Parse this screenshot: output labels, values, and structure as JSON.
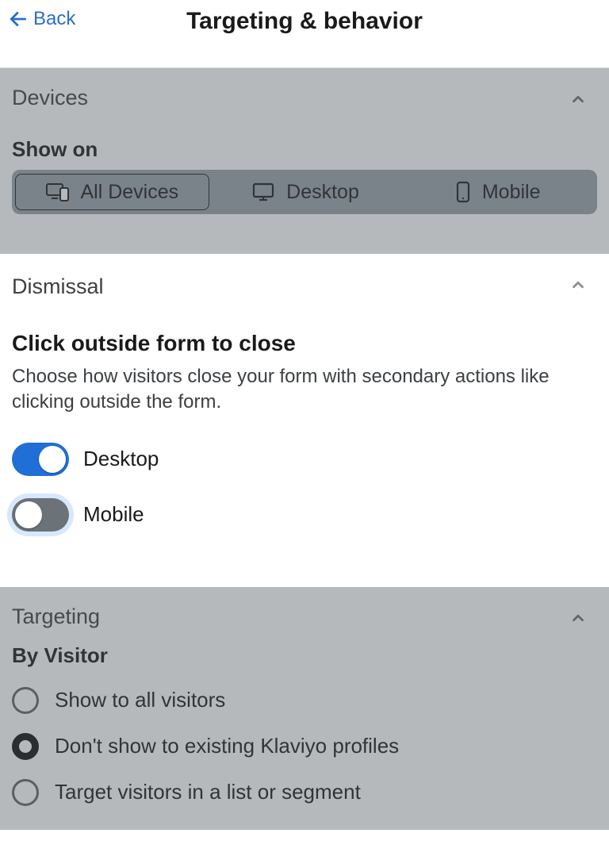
{
  "header": {
    "back_label": "Back",
    "title": "Targeting & behavior"
  },
  "devices": {
    "title": "Devices",
    "show_on_label": "Show on",
    "options": {
      "all": "All Devices",
      "desktop": "Desktop",
      "mobile": "Mobile"
    }
  },
  "dismissal": {
    "title": "Dismissal",
    "subheading": "Click outside form to close",
    "description": "Choose how visitors close your form with secondary actions like clicking outside the form.",
    "toggles": {
      "desktop": {
        "label": "Desktop",
        "on": true
      },
      "mobile": {
        "label": "Mobile",
        "on": false
      }
    }
  },
  "targeting": {
    "title": "Targeting",
    "by_visitor_label": "By Visitor",
    "options": [
      {
        "label": "Show to all visitors",
        "selected": false
      },
      {
        "label": "Don't show to existing Klaviyo profiles",
        "selected": true
      },
      {
        "label": "Target visitors in a list or segment",
        "selected": false
      }
    ]
  }
}
